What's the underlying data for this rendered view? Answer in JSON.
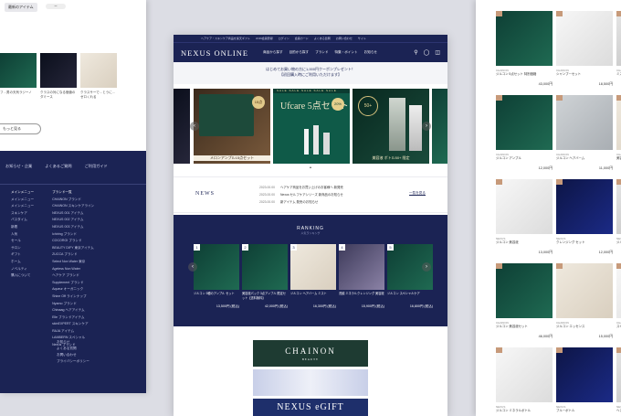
{
  "left": {
    "chip": "最新のアイテム",
    "pill": "ー",
    "captions": [
      "フ…男の天気ラジーノ",
      "クラスの対になる価値のダミース",
      "クラスサーで…とうに…ゼロくれる"
    ],
    "more_label": "もっと見る",
    "footer_links": [
      "お知らせ・企業",
      "よくあるご質問",
      "ご利用ガイド"
    ],
    "col1_title": "メインメニュー",
    "col1": [
      "メインメニュー",
      "メインメニュー",
      "スキンケア",
      "バスタイム",
      "新着",
      "人気",
      "セール",
      "サロン",
      "ギフト",
      "ホーム",
      "ノベルティ",
      "購入について"
    ],
    "col2_title": "ブランド一覧",
    "col2": [
      "CHAINON ブランド",
      "CHAINON スキンケアライン",
      "NEXUS 001 アイテム",
      "NEXUS 002 アイテム",
      "NEXUS 003 アイテム",
      "Ichiring ブランド",
      "COCOROI ブランド",
      "BEAUTY DIFY 東京アイテム",
      "ZUCCA ブランド",
      "Select Non Water 東京",
      "Ageless Non Water",
      "ヘアケア ブランド",
      "Supplement ブランド",
      "Aqueur オーガニック",
      "Shine Off ラインナップ",
      "Nyamo ブランド",
      "Chinaag ヘアアイテム",
      "Elle ブランドアイテム",
      "skinEXPERT スキンケア",
      "RAJA アイテム",
      "LAMBERN スペシャル",
      "Nexus ブランド"
    ],
    "bottom": [
      "お知らせ",
      "よくある質問",
      "お問い合わせ",
      "プライバシーポリシー"
    ]
  },
  "center": {
    "topbar": [
      "ヘアケア・スキンケア商品を楽天ギフト",
      "JOIN会員登録",
      "ログイン",
      "会員カード",
      "よくある質問",
      "お問い合わせ",
      "サイト"
    ],
    "logo": "NEXUS ONLINE",
    "nav": [
      "商品から探す",
      "目的から探す",
      "ブランド",
      "特集・ポイント",
      "お知らせ"
    ],
    "banner_lines": [
      "はじめてお買い物の方に1,000円クーポンプレゼント！",
      "【初回購入時にご利用いただけます】"
    ],
    "slides": [
      {
        "text": "アンプル15点セット",
        "badge": "15点"
      },
      {
        "text": "Ufcare 5点セット",
        "badge": "20%"
      },
      {
        "text": "ボトル50+ セット",
        "badge": "50+"
      }
    ],
    "slide_texts": {
      "a": "メロンアンプル15点セット",
      "b": "Ufcare 5点セット",
      "c": "美容液 ボトル50+ 限定"
    },
    "news": {
      "title": "NEWS",
      "more": "一覧を見る",
      "items": [
        {
          "date": "2023.00.00",
          "text": "ヘアケア商品をお買い上げのお客様へ 新発売"
        },
        {
          "date": "2023.00.00",
          "text": "Nexus セルフケアシリーズ 新商品のお知らせ"
        },
        {
          "date": "2023.00.00",
          "text": "新アイテム 発売のお知らせ"
        }
      ]
    },
    "ranking": {
      "title": "RANKING",
      "subtitle": "人気ランキング",
      "items": [
        {
          "rank": "1",
          "name": "ジルコン 3種のアンプル セット",
          "price": "13,500円 (税込)"
        },
        {
          "rank": "2",
          "name": "美容液パック 3点アンプル 限定セット【送料無料】",
          "price": "42,000円 (税込)"
        },
        {
          "rank": "3",
          "name": "ジルコン ヘアバーム ミスト",
          "price": "16,300円 (税込)"
        },
        {
          "rank": "4",
          "name": "洗顔 ミネラルクレンジング 美容液",
          "price": "15,900円 (税込)"
        },
        {
          "rank": "5",
          "name": "ジルコン スペシャルケア",
          "price": "16,800円 (税込)"
        }
      ]
    },
    "promos": {
      "chainon": "CHAINON",
      "chainon_sub": "BEAUTY",
      "gift": "NEXUS eGIFT"
    }
  },
  "right": {
    "products": [
      {
        "cat": "CHAINON",
        "name": "ジルコン 5点セット 特別価格",
        "price": "43,000円",
        "art": "g-green"
      },
      {
        "cat": "CHAINON",
        "name": "シャンプーセット",
        "price": "18,500円",
        "art": "g-white"
      },
      {
        "cat": "CHAINON",
        "name": "ミスト 3点",
        "price": "14,000円",
        "art": "g-grey2"
      },
      {
        "cat": "CHAINON",
        "name": "ジルコン アンプル",
        "price": "12,000円",
        "art": "g-green"
      },
      {
        "cat": "CHAINON",
        "name": "ジルコン ヘアバーム",
        "price": "11,000円",
        "art": "g-gray"
      },
      {
        "cat": "CHAINON",
        "name": "美容セット",
        "price": "11,000円",
        "art": "g-cream"
      },
      {
        "cat": "NEXUS",
        "name": "ジルコン 美容液",
        "price": "13,000円",
        "art": "g-white"
      },
      {
        "cat": "NEXUS",
        "name": "クレンジング セット",
        "price": "12,000円",
        "art": "g-navy"
      },
      {
        "cat": "NEXUS",
        "name": "ジルコン ミスト",
        "price": "16,000円",
        "art": "g-grey2"
      },
      {
        "cat": "CHAINON",
        "name": "ジルコン 美容液セット",
        "price": "46,000円",
        "art": "g-green"
      },
      {
        "cat": "CHAINON",
        "name": "ジルコン エッセンス",
        "price": "15,000円",
        "art": "g-cream"
      },
      {
        "cat": "CHAINON",
        "name": "スキンケア 5点セット",
        "price": "12,000円",
        "art": "g-white"
      },
      {
        "cat": "NEXUS",
        "name": "ジルコン ミネラルボトル",
        "price": "13,600円",
        "art": "g-white"
      },
      {
        "cat": "NEXUS",
        "name": "ブルーボトル",
        "price": "9,800円",
        "art": "g-navy"
      },
      {
        "cat": "NEXUS",
        "name": "ヘアオイル",
        "price": "8,800円",
        "art": "g-grey2"
      }
    ]
  }
}
